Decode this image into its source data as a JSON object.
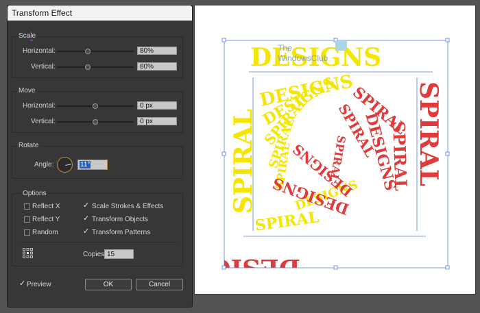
{
  "dialog": {
    "title": "Transform Effect",
    "scale": {
      "group_label": "Scale",
      "horizontal_label": "Horizontal:",
      "horizontal_value": "80%",
      "vertical_label": "Vertical:",
      "vertical_value": "80%"
    },
    "move": {
      "group_label": "Move",
      "horizontal_label": "Horizontal:",
      "horizontal_value": "0 px",
      "vertical_label": "Vertical:",
      "vertical_value": "0 px"
    },
    "rotate": {
      "group_label": "Rotate",
      "angle_label": "Angle:",
      "angle_value": "11°"
    },
    "options": {
      "group_label": "Options",
      "reflect_x": "Reflect X",
      "reflect_y": "Reflect Y",
      "random": "Random",
      "scale_strokes": "Scale Strokes & Effects",
      "transform_objects": "Transform Objects",
      "transform_patterns": "Transform Patterns",
      "copies_label": "Copies",
      "copies_value": "15"
    },
    "preview_label": "Preview",
    "ok_label": "OK",
    "cancel_label": "Cancel"
  },
  "artwork": {
    "word_top": "DESIGNS",
    "word_side": "SPIRAL",
    "yellow": "#f5e600",
    "red": "#e03a3a"
  },
  "watermark": {
    "line1": "The",
    "line2": "WindowsClub"
  }
}
